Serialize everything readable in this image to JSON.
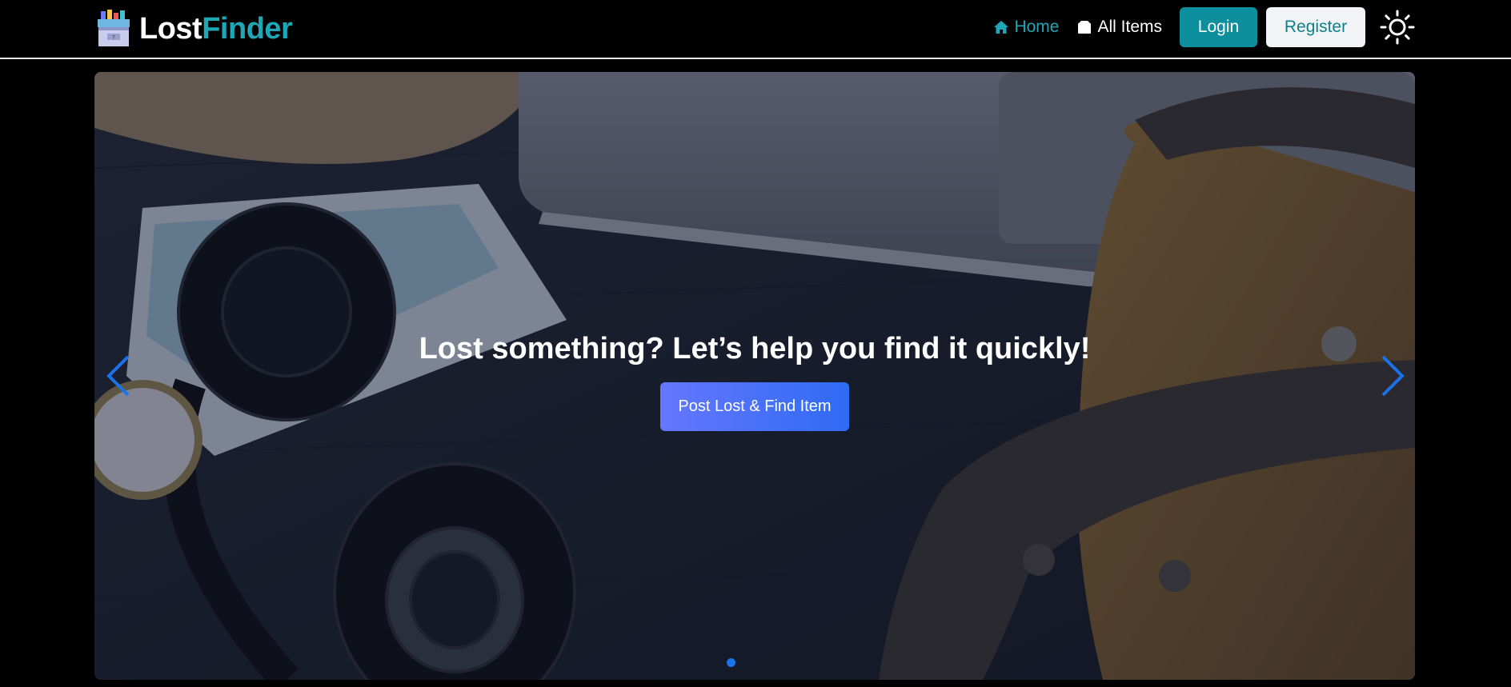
{
  "brand": {
    "lost": "Lost",
    "finder": "Finder",
    "logo_icon": "lost-and-found-box-icon",
    "finder_color": "#1ea7b6"
  },
  "nav": {
    "home": {
      "label": "Home",
      "icon": "home-icon"
    },
    "all_items": {
      "label": "All Items",
      "icon": "box-icon"
    },
    "login": "Login",
    "register": "Register",
    "theme_icon": "sun-icon"
  },
  "hero": {
    "title": "Lost something? Let’s help you find it quickly!",
    "cta": "Post Lost & Find Item",
    "prev_icon": "chevron-left-icon",
    "next_icon": "chevron-right-icon",
    "slide_count_visible": 1,
    "active_slide": 1
  },
  "colors": {
    "accent": "#1ea7b6",
    "login_bg": "#0e8f9e",
    "cta_start": "#6577ff",
    "cta_end": "#2f6bf3",
    "indicator": "#1a73e8"
  }
}
